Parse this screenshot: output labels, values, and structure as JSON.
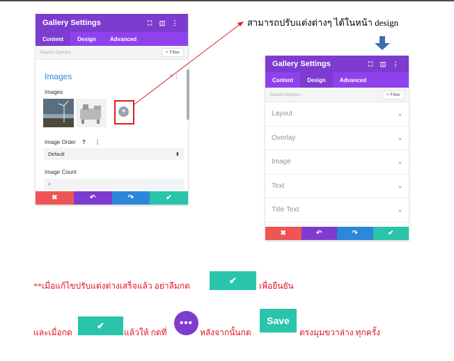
{
  "colors": {
    "purple": "#7e3bd0",
    "purple_light": "#8f42ec",
    "blue": "#2b87da",
    "teal": "#29c4a9",
    "red": "#ef5555",
    "annotation_red": "#e21b1b"
  },
  "left_panel": {
    "title": "Gallery Settings",
    "tabs": [
      "Content",
      "Design",
      "Advanced"
    ],
    "active_tab": "Content",
    "search_placeholder": "Search Options",
    "filter_label": "+ Filter",
    "section_title": "Images",
    "images_label": "Images",
    "thumbnails": [
      "wind-turbine-thumbnail",
      "machine-thumbnail"
    ],
    "add_icon": "plus-circle-icon",
    "image_order_label": "Image Order",
    "help_mark": "?",
    "image_order_value": "Default",
    "image_count_label": "Image Count",
    "image_count_value": "4"
  },
  "right_panel": {
    "title": "Gallery Settings",
    "tabs": [
      "Content",
      "Design",
      "Advanced"
    ],
    "active_tab": "Design",
    "search_placeholder": "Search Options",
    "filter_label": "+ Filter",
    "groups": [
      "Layout",
      "Overlay",
      "Image",
      "Text",
      "Title Text"
    ]
  },
  "footer_icons": [
    "close-icon",
    "undo-icon",
    "redo-icon",
    "check-icon"
  ],
  "callout_text": "สามารถปรับแต่งต่างๆ ได้ในหน้า design",
  "instructions": {
    "line1_part1": "**เมื่อแก้ไขปรับแต่งต่างเสร็จแล้ว อย่าลืมกด",
    "line1_part2": "เพื่อยืนยัน",
    "line2_part1": "และเมื่อกด",
    "line2_part2": "แล้วให้ กดที่",
    "line2_part3": "หลังจากนั้นกด",
    "line2_part4": "ตรงมุมขวาล่าง ทุกครั้ง",
    "dots_label": "•••",
    "save_label": "Save"
  }
}
